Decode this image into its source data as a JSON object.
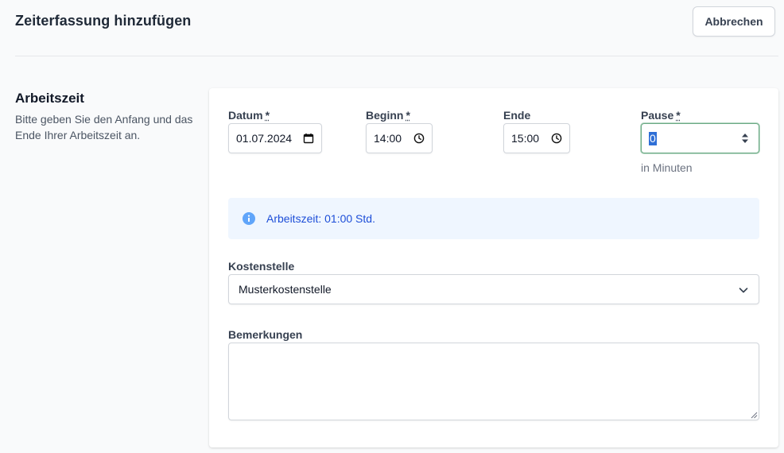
{
  "header": {
    "title": "Zeiterfassung hinzufügen",
    "cancel_label": "Abbrechen"
  },
  "section": {
    "title": "Arbeitszeit",
    "description": "Bitte geben Sie den Anfang und das Ende Ihrer Arbeitszeit an."
  },
  "form": {
    "datum": {
      "label": "Datum",
      "required_mark": "*",
      "value": "01.07.2024"
    },
    "beginn": {
      "label": "Beginn",
      "required_mark": "*",
      "value": "14:00"
    },
    "ende": {
      "label": "Ende",
      "value": "15:00"
    },
    "pause": {
      "label": "Pause",
      "required_mark": "*",
      "value": "0",
      "hint": "in Minuten"
    },
    "info": {
      "text": "Arbeitszeit: 01:00 Std."
    },
    "kostenstelle": {
      "label": "Kostenstelle",
      "value": "Musterkostenstelle"
    },
    "bemerkungen": {
      "label": "Bemerkungen",
      "value": ""
    }
  },
  "colors": {
    "page_bg": "#f9fafb",
    "info_bg": "#eff6ff",
    "info_text": "#1d4ed8",
    "focus_border": "#6aa984",
    "selection": "#2f6fd6"
  },
  "icons": {
    "datum": "calendar-icon",
    "beginn": "clock-icon",
    "ende": "clock-icon",
    "pause": "spinner-arrows-icon",
    "info": "info-circle-icon",
    "kostenstelle": "chevron-down-icon",
    "bemerkungen": "resize-grip-icon"
  }
}
